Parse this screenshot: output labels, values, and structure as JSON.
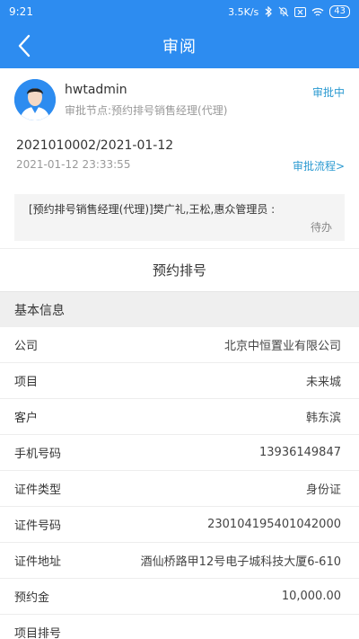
{
  "statusbar": {
    "time": "9:21",
    "speed": "3.5K/s",
    "battery": "43"
  },
  "header": {
    "title": "审阅"
  },
  "applicant": {
    "name": "hwtadmin",
    "node": "审批节点:预约排号销售经理(代理)",
    "status": "审批中",
    "doc_no": "2021010002/2021-01-12",
    "time": "2021-01-12 23:33:55",
    "flow_link": "审批流程>"
  },
  "flow": {
    "text": "[预约排号销售经理(代理)]樊广礼,王松,惠众管理员 :",
    "status": "待办"
  },
  "section": {
    "title": "预约排号",
    "header": "基本信息"
  },
  "fields": [
    {
      "label": "公司",
      "value": "北京中恒置业有限公司"
    },
    {
      "label": "项目",
      "value": "未来城"
    },
    {
      "label": "客户",
      "value": "韩东滨"
    },
    {
      "label": "手机号码",
      "value": "13936149847"
    },
    {
      "label": "证件类型",
      "value": "身份证"
    },
    {
      "label": "证件号码",
      "value": "230104195401042000"
    },
    {
      "label": "证件地址",
      "value": "酒仙桥路甲12号电子城科技大厦6-610"
    },
    {
      "label": "预约金",
      "value": "10,000.00"
    },
    {
      "label": "项目排号",
      "value": ""
    }
  ]
}
